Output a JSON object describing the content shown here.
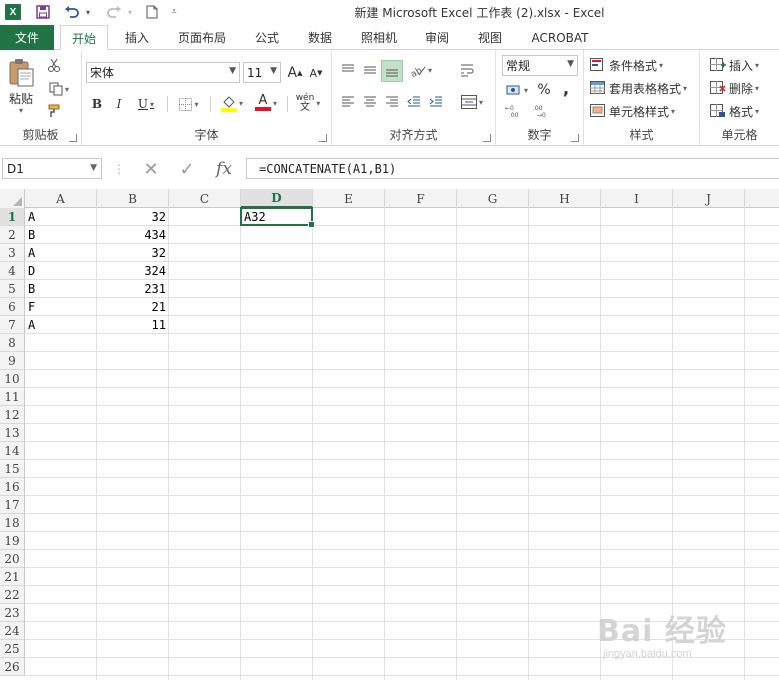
{
  "window": {
    "title": "新建 Microsoft Excel 工作表 (2).xlsx - Excel",
    "app_icon_letter": "X"
  },
  "quick_access": {
    "save_icon": "save-icon",
    "undo_icon": "undo-icon",
    "redo_icon": "redo-icon",
    "new_icon": "new-document-icon",
    "customize_icon": "customize-qat-icon"
  },
  "tabs": {
    "file": "文件",
    "items": [
      "开始",
      "插入",
      "页面布局",
      "公式",
      "数据",
      "照相机",
      "审阅",
      "视图",
      "ACROBAT"
    ],
    "active_index": 0
  },
  "ribbon": {
    "clipboard": {
      "label": "剪贴板",
      "paste_label": "粘贴"
    },
    "font": {
      "label": "字体",
      "font_name": "宋体",
      "font_size": "11",
      "bold": "B",
      "italic": "I",
      "underline": "U",
      "increase_size": "A",
      "decrease_size": "A",
      "font_color_letter": "A",
      "phonetic": "wén"
    },
    "alignment": {
      "label": "对齐方式"
    },
    "number": {
      "label": "数字",
      "format": "常规",
      "percent": "%",
      "comma": ","
    },
    "styles": {
      "label": "样式",
      "conditional": "条件格式",
      "table_format": "套用表格格式",
      "cell_styles": "单元格样式"
    },
    "cells": {
      "label": "单元格",
      "insert": "插入",
      "delete": "删除",
      "format": "格式"
    }
  },
  "formula_bar": {
    "name_box": "D1",
    "formula": "=CONCATENATE(A1,B1)",
    "fx": "fx"
  },
  "sheet": {
    "columns": [
      "A",
      "B",
      "C",
      "D",
      "E",
      "F",
      "G",
      "H",
      "I",
      "J"
    ],
    "rows": [
      "1",
      "2",
      "3",
      "4",
      "5",
      "6",
      "7",
      "8",
      "9",
      "10",
      "11",
      "12",
      "13",
      "14",
      "15",
      "16",
      "17",
      "18",
      "19",
      "20",
      "21",
      "22",
      "23",
      "24",
      "25",
      "26"
    ],
    "selected_column": "D",
    "selected_row": "1",
    "cells": {
      "A": [
        "A",
        "B",
        "A",
        "D",
        "B",
        "F",
        "A"
      ],
      "B": [
        "32",
        "434",
        "32",
        "324",
        "231",
        "21",
        "11"
      ],
      "D1": "A32"
    }
  },
  "watermark": {
    "logo": "Bai 经验",
    "url": "jingyan.baidu.com"
  },
  "colors": {
    "accent": "#217346",
    "header_bg": "#f3f3f3",
    "selected_header_bg": "#e1e1e1"
  }
}
